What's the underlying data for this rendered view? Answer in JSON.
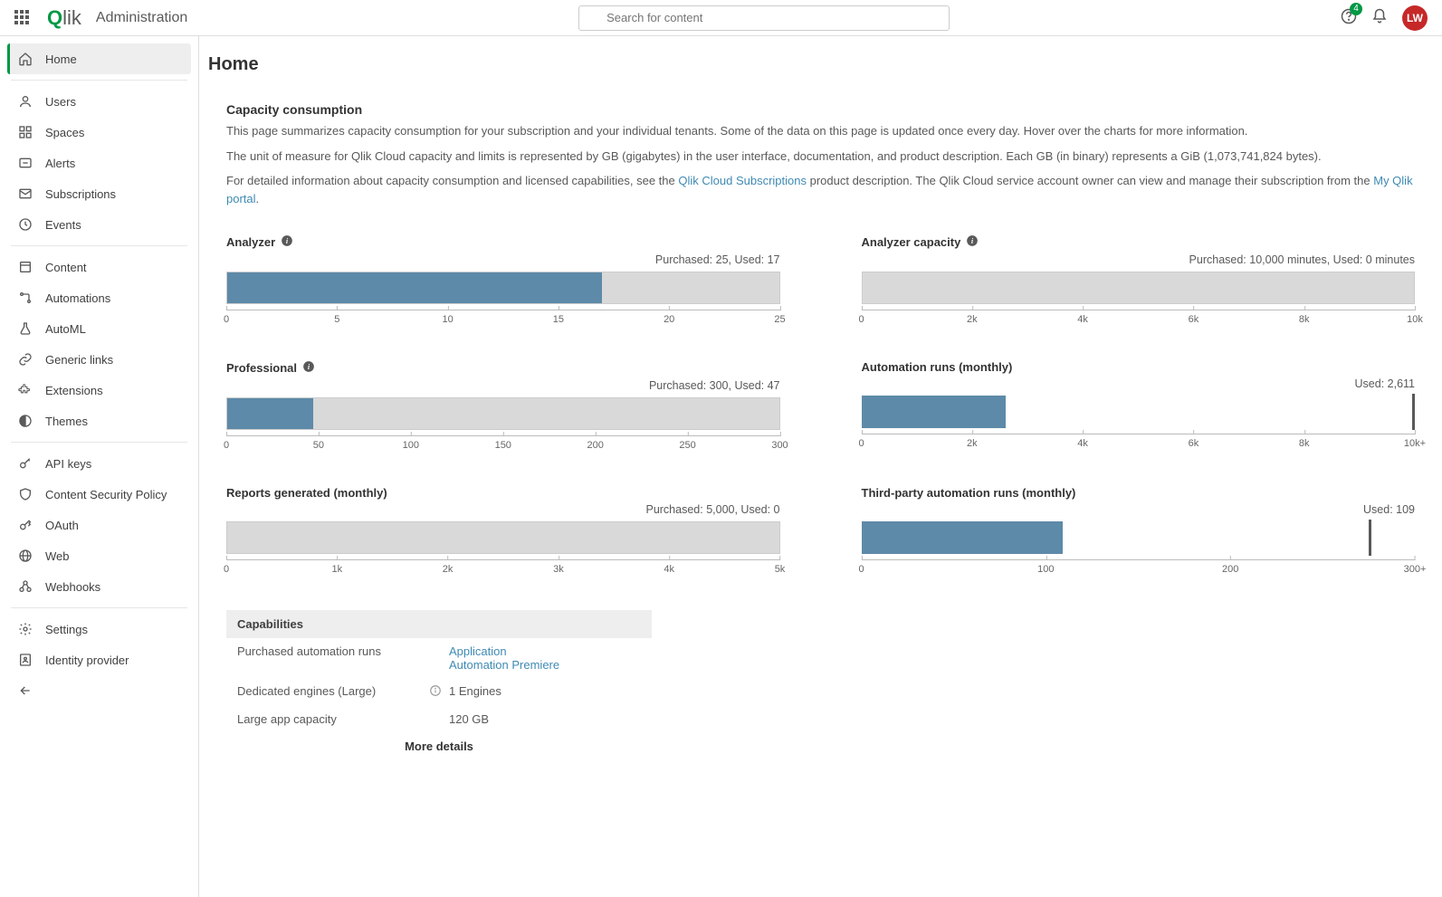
{
  "header": {
    "app_name": "Administration",
    "search_placeholder": "Search for content",
    "notification_count": "4",
    "avatar_initials": "LW"
  },
  "sidebar": {
    "groups": [
      [
        {
          "label": "Home",
          "icon": "home",
          "active": true
        }
      ],
      [
        {
          "label": "Users",
          "icon": "user"
        },
        {
          "label": "Spaces",
          "icon": "spaces"
        },
        {
          "label": "Alerts",
          "icon": "alert"
        },
        {
          "label": "Subscriptions",
          "icon": "mail"
        },
        {
          "label": "Events",
          "icon": "clock"
        }
      ],
      [
        {
          "label": "Content",
          "icon": "content"
        },
        {
          "label": "Automations",
          "icon": "automation"
        },
        {
          "label": "AutoML",
          "icon": "flask"
        },
        {
          "label": "Generic links",
          "icon": "link"
        },
        {
          "label": "Extensions",
          "icon": "puzzle"
        },
        {
          "label": "Themes",
          "icon": "theme"
        }
      ],
      [
        {
          "label": "API keys",
          "icon": "key"
        },
        {
          "label": "Content Security Policy",
          "icon": "shield"
        },
        {
          "label": "OAuth",
          "icon": "oauth"
        },
        {
          "label": "Web",
          "icon": "web"
        },
        {
          "label": "Webhooks",
          "icon": "webhook"
        }
      ],
      [
        {
          "label": "Settings",
          "icon": "gear"
        },
        {
          "label": "Identity provider",
          "icon": "idp"
        }
      ]
    ]
  },
  "page": {
    "title": "Home",
    "section_title": "Capacity consumption",
    "desc1": "This page summarizes capacity consumption for your subscription and your individual tenants. Some of the data on this page is updated once every day. Hover over the charts for more information.",
    "desc2": "The unit of measure for Qlik Cloud capacity and limits is represented by GB (gigabytes) in the user interface, documentation, and product description. Each GB (in binary) represents a GiB (1,073,741,824 bytes).",
    "desc3_pre": "For detailed information about capacity consumption and licensed capabilities, see the ",
    "desc3_link1": "Qlik Cloud Subscriptions",
    "desc3_mid": " product description. The Qlik Cloud service account owner can view and manage their subscription from the ",
    "desc3_link2": "My Qlik portal",
    "desc3_post": "."
  },
  "chart_data": [
    {
      "id": "analyzer",
      "type": "bar",
      "title": "Analyzer",
      "subtitle": "Purchased: 25, Used: 17",
      "purchased": 25,
      "used": 17,
      "max": 25,
      "ticks": [
        0,
        5,
        10,
        15,
        20,
        25
      ],
      "info": true
    },
    {
      "id": "analyzer_capacity",
      "type": "bar",
      "title": "Analyzer capacity",
      "subtitle": "Purchased: 10,000 minutes, Used: 0 minutes",
      "purchased": 10000,
      "used": 0,
      "max": 10000,
      "ticks": [
        0,
        2000,
        4000,
        6000,
        8000,
        10000
      ],
      "tick_labels": [
        "0",
        "2k",
        "4k",
        "6k",
        "8k",
        "10k"
      ],
      "info": true
    },
    {
      "id": "professional",
      "type": "bar",
      "title": "Professional",
      "subtitle": "Purchased: 300, Used: 47",
      "purchased": 300,
      "used": 47,
      "max": 300,
      "ticks": [
        0,
        50,
        100,
        150,
        200,
        250,
        300
      ],
      "info": true
    },
    {
      "id": "automation_runs",
      "type": "bar",
      "title": "Automation runs (monthly)",
      "subtitle": "Used: 2,611",
      "used": 2611,
      "max": 10000,
      "ticks": [
        0,
        2000,
        4000,
        6000,
        8000,
        10000
      ],
      "tick_labels": [
        "0",
        "2k",
        "4k",
        "6k",
        "8k",
        "10k+"
      ],
      "marker": 10000,
      "no_track": true
    },
    {
      "id": "reports",
      "type": "bar",
      "title": "Reports generated (monthly)",
      "subtitle": "Purchased: 5,000, Used: 0",
      "purchased": 5000,
      "used": 0,
      "max": 5000,
      "ticks": [
        0,
        1000,
        2000,
        3000,
        4000,
        5000
      ],
      "tick_labels": [
        "0",
        "1k",
        "2k",
        "3k",
        "4k",
        "5k"
      ]
    },
    {
      "id": "third_party",
      "type": "bar",
      "title": "Third-party automation runs (monthly)",
      "subtitle": "Used: 109",
      "used": 109,
      "max": 300,
      "ticks": [
        0,
        100,
        200,
        300
      ],
      "tick_labels": [
        "0",
        "100",
        "200",
        "300+"
      ],
      "marker": 275,
      "no_track": true
    }
  ],
  "capabilities": {
    "header": "Capabilities",
    "rows": [
      {
        "label": "Purchased automation runs",
        "links": [
          "Application",
          "Automation Premiere"
        ]
      },
      {
        "label": "Dedicated engines (Large)",
        "value": "1 Engines",
        "info": true
      },
      {
        "label": "Large app capacity",
        "value": "120 GB"
      }
    ],
    "more": "More details"
  }
}
